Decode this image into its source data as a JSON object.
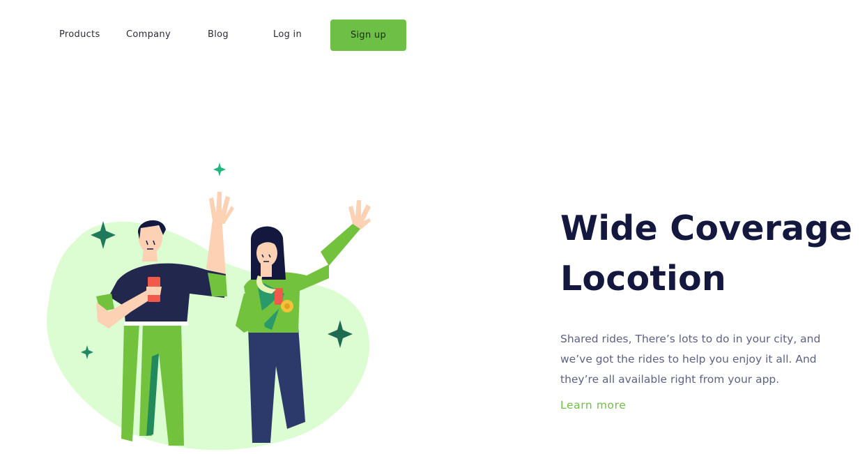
{
  "nav": {
    "products": "Products",
    "company": "Company",
    "blog": "Blog",
    "login": "Log in",
    "signup": "Sign up"
  },
  "hero": {
    "title_line1": "Wide Coverage",
    "title_line2": "Locotion",
    "description": "Shared rides, There’s lots to do in your city, and we’ve got the rides to help you enjoy it all. And they’re all available right from your app.",
    "cta": "Learn more"
  },
  "theme": {
    "accent": "#6dbf45",
    "title_color": "#14183e",
    "text_color": "#5e6282",
    "blob_color": "#dcfcd1",
    "sparkle_color": "#1f7a5c"
  }
}
